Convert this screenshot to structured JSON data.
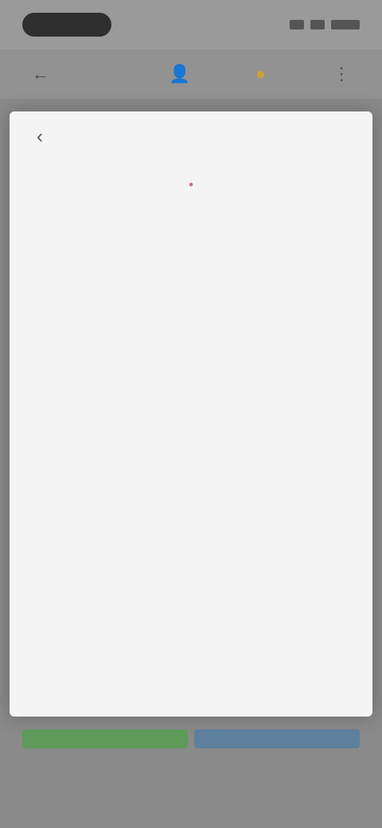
{
  "status_bar": {
    "time_label": "",
    "battery_label": ""
  },
  "app_bar": {
    "nav_label": "",
    "icons": [
      "back-icon",
      "profile-icon",
      "coin-icon"
    ]
  },
  "sheet": {
    "title": "",
    "sections": [
      {
        "heading": "",
        "paragraphs": [
          "",
          ""
        ]
      },
      {
        "heading": "",
        "paragraphs": [
          "",
          "",
          ""
        ]
      },
      {
        "heading": "",
        "paragraphs": [
          "",
          ""
        ]
      }
    ]
  },
  "actions": {
    "primary_label": "",
    "secondary_label": ""
  },
  "colors": {
    "overlay": "#8a8a8a",
    "accent_green": "#5e9a5a",
    "accent_blue": "#5f7f9e",
    "highlight": "#d46a7a"
  }
}
